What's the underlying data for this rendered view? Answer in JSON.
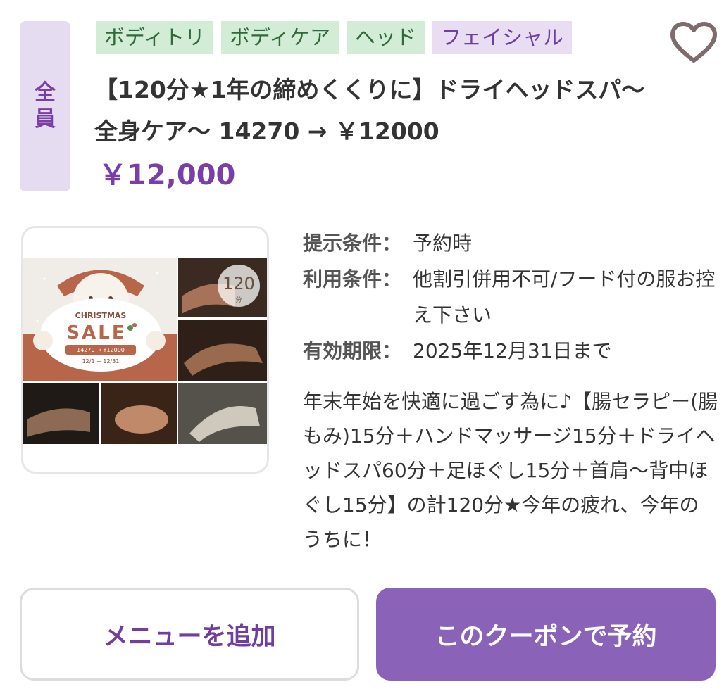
{
  "coupon": {
    "target_line1": "全",
    "target_line2": "員",
    "tags": [
      {
        "label": "ボディトリ",
        "color": "green"
      },
      {
        "label": "ボディケア",
        "color": "green"
      },
      {
        "label": "ヘッド",
        "color": "green"
      },
      {
        "label": "フェイシャル",
        "color": "purple"
      }
    ],
    "favorite_icon": "heart-outline-icon",
    "title": "【120分★1年の締めくくりに】ドライヘッドスパ～全身ケア～ 14270 → ￥12000",
    "price": "￥12,000",
    "thumbnail": {
      "christmas_label": "CHRISTMAS",
      "sale_label": "SALE",
      "sale_prices": "14270 → ¥12000",
      "sale_dates": "12/1 ~ 12/31",
      "duration_number": "120",
      "duration_unit": "分"
    },
    "conditions": [
      {
        "label": "提示条件：",
        "value": "予約時"
      },
      {
        "label": "利用条件：",
        "value": "他割引併用不可/フード付の服お控え下さい"
      },
      {
        "label": "有効期限：",
        "value": "2025年12月31日まで"
      }
    ],
    "description": "年末年始を快適に過ごす為に♪【腸セラピー(腸もみ)15分＋ハンドマッサージ15分＋ドライヘッドスパ60分＋足ほぐし15分＋首肩～背中ほぐし15分】の計120分★今年の疲れ、今年のうちに！"
  },
  "actions": {
    "add_menu_label": "メニューを追加",
    "reserve_label": "このクーポンで予約"
  },
  "colors": {
    "accent_purple": "#7a3ea8",
    "button_purple": "#8a63b8",
    "tag_green_bg": "#d3ecd6",
    "tag_purple_bg": "#e9ddf3",
    "badge_bg": "#e6dcf2"
  }
}
